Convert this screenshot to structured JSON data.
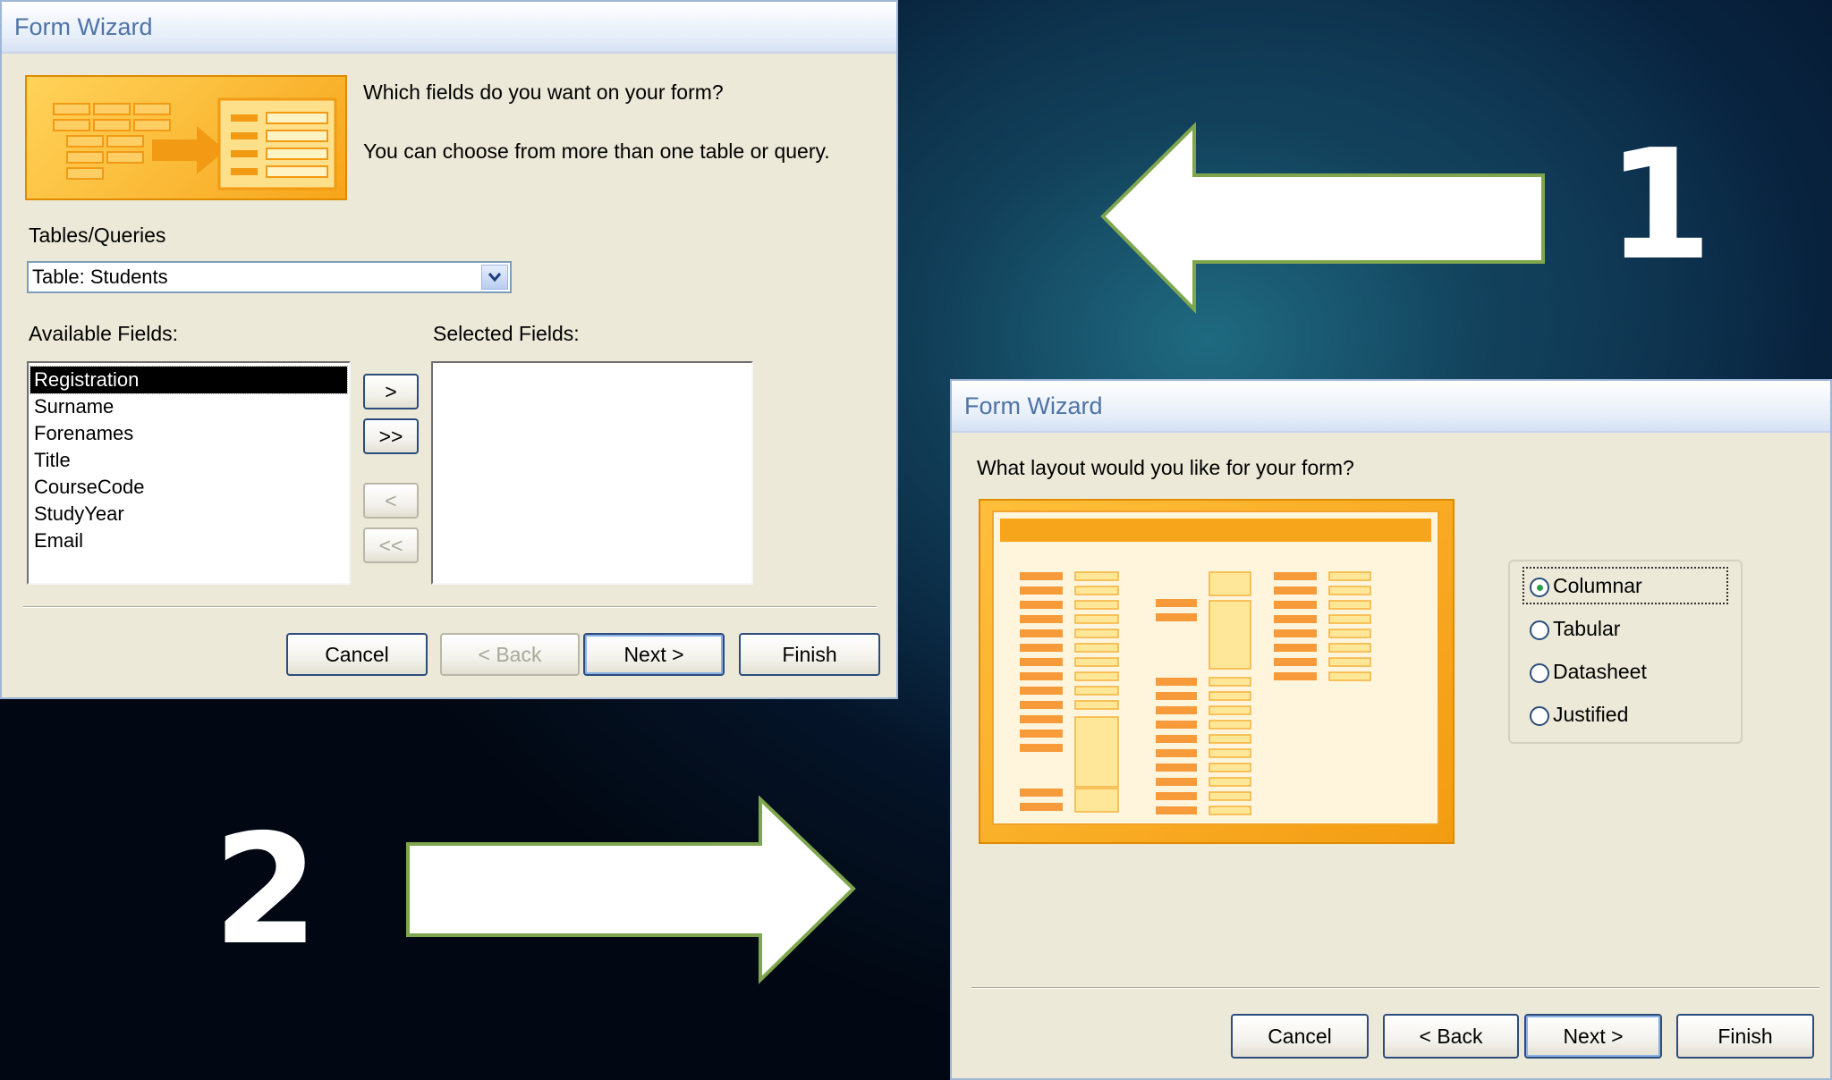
{
  "dialog1": {
    "title": "Form Wizard",
    "question": "Which fields do you want on your form?",
    "hint": "You can choose from more than one table or query.",
    "tables_label": "Tables/Queries",
    "table_value": "Table: Students",
    "available_label": "Available Fields:",
    "selected_label": "Selected Fields:",
    "available_fields": [
      "Registration",
      "Surname",
      "Forenames",
      "Title",
      "CourseCode",
      "StudyYear",
      "Email"
    ],
    "move_one": ">",
    "move_all": ">>",
    "remove_one": "<",
    "remove_all": "<<",
    "cancel": "Cancel",
    "back": "< Back",
    "next": "Next >",
    "finish": "Finish"
  },
  "dialog2": {
    "title": "Form Wizard",
    "question": "What layout would you like for your form?",
    "options": [
      "Columnar",
      "Tabular",
      "Datasheet",
      "Justified"
    ],
    "selected_option": "Columnar",
    "cancel": "Cancel",
    "back": "< Back",
    "next": "Next >",
    "finish": "Finish"
  },
  "annotations": {
    "step1": "1",
    "step2": "2"
  },
  "colors": {
    "accent_orange": "#f7a51a",
    "title_blue": "#4e73a6",
    "dialog_bg": "#ece9d8"
  }
}
